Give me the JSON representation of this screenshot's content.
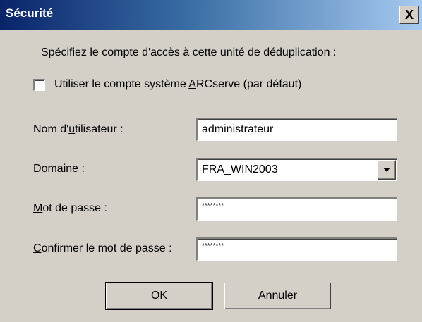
{
  "window": {
    "title": "Sécurité",
    "close_label": "X"
  },
  "instruction": "Spécifiez le compte d'accès à cette unité de déduplication :",
  "checkbox": {
    "label_pre": "Utiliser le compte système ",
    "label_mnemonic": "A",
    "label_post": "RCserve (par défaut)",
    "checked": false
  },
  "username": {
    "label_pre": "Nom d'",
    "label_mnemonic": "u",
    "label_post": "tilisateur :",
    "value": "administrateur"
  },
  "domain": {
    "label_mnemonic": "D",
    "label_post": "omaine :",
    "value": "FRA_WIN2003"
  },
  "password": {
    "label_mnemonic": "M",
    "label_post": "ot de passe :",
    "value": "********"
  },
  "confirm_password": {
    "label_mnemonic": "C",
    "label_post": "onfirmer le mot de passe :",
    "value": "********"
  },
  "buttons": {
    "ok": "OK",
    "cancel": "Annuler"
  }
}
